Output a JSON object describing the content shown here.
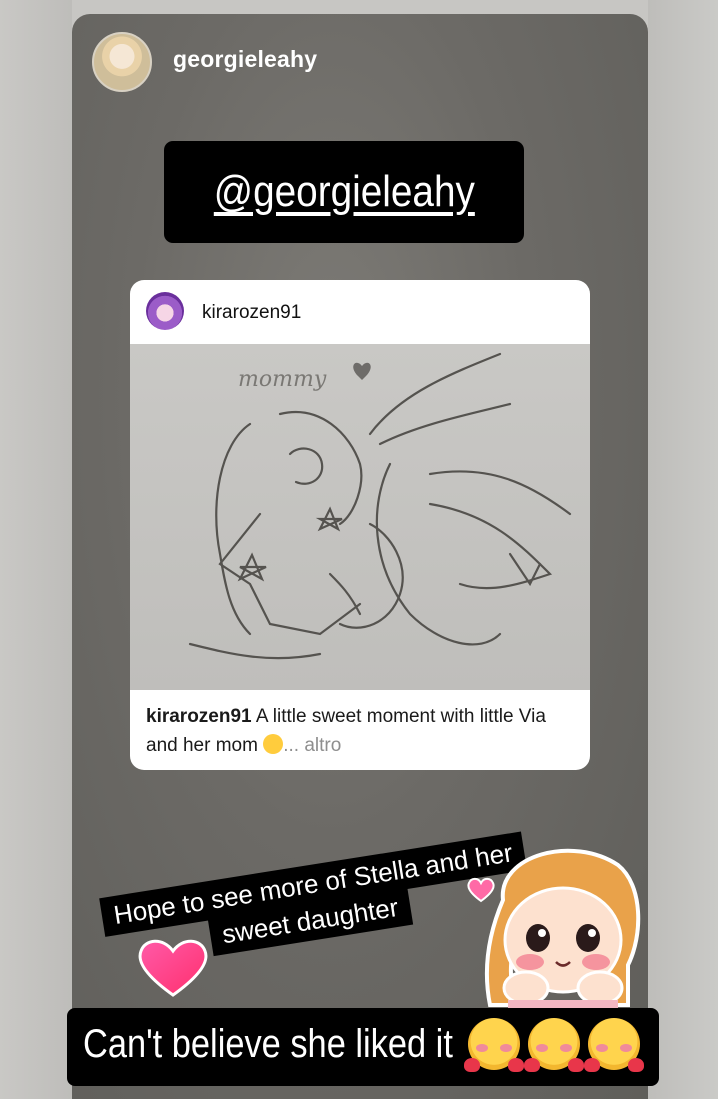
{
  "story": {
    "username": "georgieleahy",
    "mention": "@georgieleahy"
  },
  "post": {
    "username": "kirarozen91",
    "image_text": "mommy",
    "caption_user": "kirarozen91",
    "caption_text": " A little sweet moment with little Via and her mom ",
    "caption_more": "... altro"
  },
  "stickers": {
    "hope_line1": "Hope to see more of Stella and her",
    "hope_line2": "sweet daughter",
    "bottom_text": "Can't believe she liked it"
  },
  "icons": {
    "avatar": "profile-photo",
    "post_avatar": "profile-photo",
    "heart": "pink-heart-icon",
    "emoji": "smiling-face-with-hearts-icon"
  },
  "colors": {
    "story_bg": "#6c6a66",
    "sticker_bg": "#000000",
    "heart": "#ff3d8b"
  }
}
